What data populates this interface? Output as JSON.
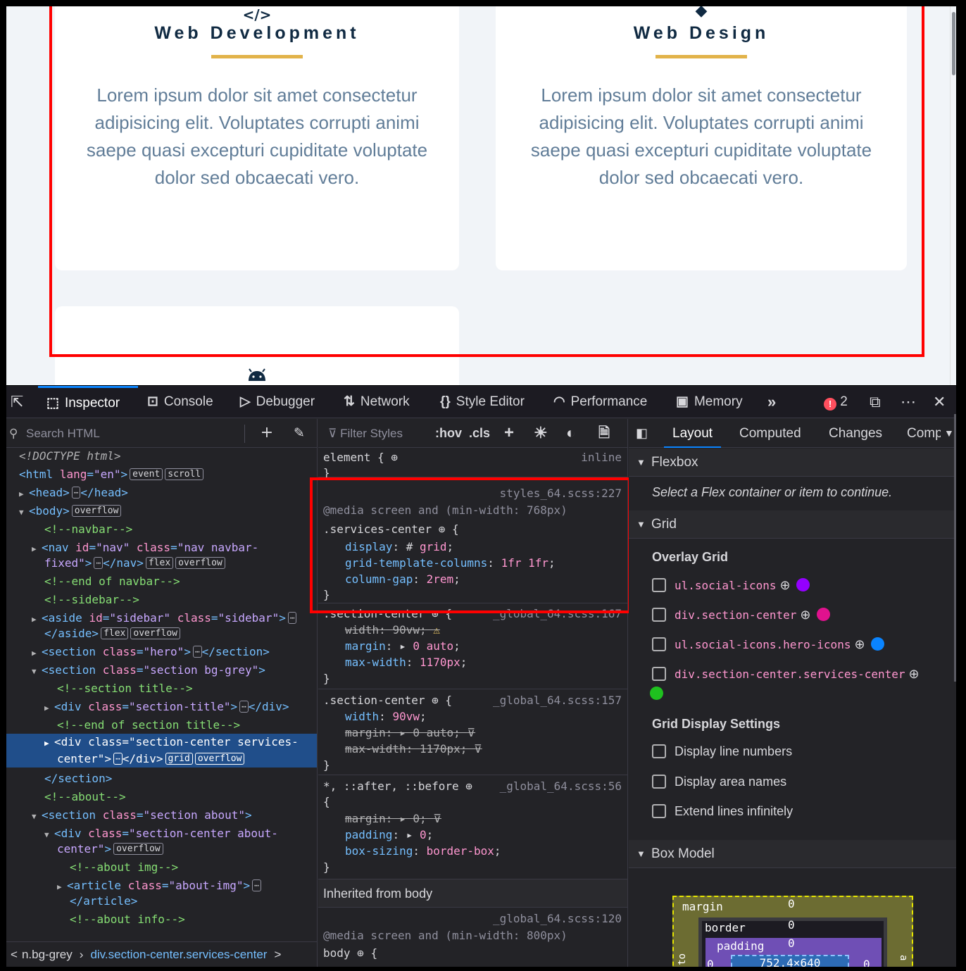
{
  "page": {
    "cards": [
      {
        "title": "Web Development",
        "icon": "</>",
        "text": "Lorem ipsum dolor sit amet consectetur adipisicing elit. Voluptates corrupti animi saepe quasi excepturi cupiditate voluptate dolor sed obcaecati vero."
      },
      {
        "title": "Web Design",
        "icon": "◆",
        "text": "Lorem ipsum dolor sit amet consectetur adipisicing elit. Voluptates corrupti animi saepe quasi excepturi cupiditate voluptate dolor sed obcaecati vero."
      }
    ]
  },
  "devtools": {
    "tabs": [
      {
        "label": "Inspector"
      },
      {
        "label": "Console"
      },
      {
        "label": "Debugger"
      },
      {
        "label": "Network"
      },
      {
        "label": "Style Editor"
      },
      {
        "label": "Performance"
      },
      {
        "label": "Memory"
      }
    ],
    "error_count": "2",
    "markup": {
      "search_placeholder": "Search HTML"
    },
    "breadcrumb": [
      "n.bg-grey",
      "div.section-center.services-center"
    ],
    "rules": {
      "filter_placeholder": "Filter Styles",
      "hov": ":hov",
      "cls": ".cls",
      "element": "element {",
      "inline": "inline",
      "r1_src": "styles_64.scss:227",
      "r1_media": "@media screen and (min-width: 768px)",
      "r1_sel": ".services-center",
      "r1_p1": "display",
      "r1_v1": "grid",
      "r1_p2": "grid-template-columns",
      "r1_v2": "1fr 1fr",
      "r1_p3": "column-gap",
      "r1_v3": "2rem",
      "r2_sel": ".section-center",
      "r2_src": "_global_64.scss:167",
      "r2_p1": "width",
      "r2_v1": "90vw",
      "r2_p2": "margin",
      "r2_v2": "0 auto",
      "r2_p3": "max-width",
      "r2_v3": "1170px",
      "r3_sel": ".section-center",
      "r3_src": "_global_64.scss:157",
      "r3_p1": "width",
      "r3_v1": "90vw",
      "r3_p2": "margin",
      "r3_v2": "0 auto",
      "r3_p3": "max-width",
      "r3_v3": "1170px",
      "r4_sel": "*, ::after, ::before",
      "r4_src": "_global_64.scss:56",
      "r4_p1": "margin",
      "r4_v1": "0",
      "r4_p2": "padding",
      "r4_v2": "0",
      "r4_p3": "box-sizing",
      "r4_v3": "border-box",
      "inherited": "Inherited from body",
      "r5_src": "_global_64.scss:120",
      "r5_media": "@media screen and (min-width: 800px)",
      "r5_sel": "body"
    },
    "layout": {
      "subtabs": [
        "Layout",
        "Computed",
        "Changes",
        "Comp"
      ],
      "flexbox": "Flexbox",
      "flex_hint": "Select a Flex container or item to continue.",
      "grid": "Grid",
      "overlay_grid": "Overlay Grid",
      "grids": [
        {
          "name": "ul.social-icons",
          "color": "#9400ff"
        },
        {
          "name": "div.section-center",
          "color": "#e0128e"
        },
        {
          "name": "ul.social-icons.hero-icons",
          "color": "#0a84ff"
        },
        {
          "name": "div.section-center.services-center",
          "color": "#1fc11f"
        }
      ],
      "display_settings": "Grid Display Settings",
      "settings": [
        "Display line numbers",
        "Display area names",
        "Extend lines infinitely"
      ],
      "box_model": "Box Model",
      "bm": {
        "margin": "margin",
        "border": "border",
        "padding": "padding",
        "zero": "0",
        "size": "752.4×640",
        "side_left": "to",
        "side_right": "a"
      }
    }
  }
}
